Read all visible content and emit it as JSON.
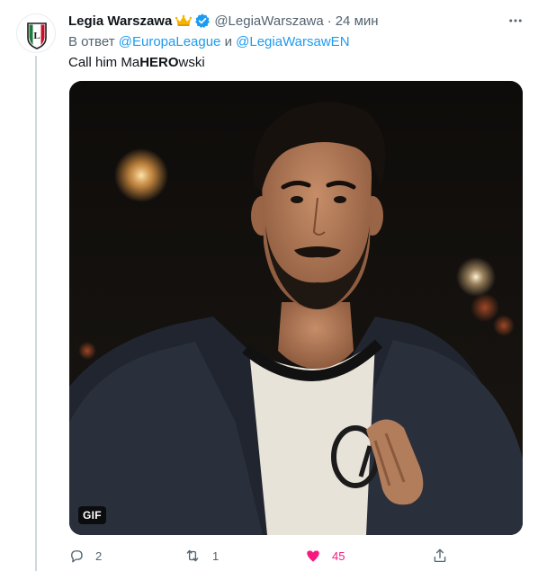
{
  "tweet": {
    "author_name": "Legia Warszawa",
    "handle": "@LegiaWarszawa",
    "separator": "·",
    "time": "24 мин",
    "reply_prefix": "В ответ",
    "reply_mention_1": "@EuropaLeague",
    "reply_conjunction": "и",
    "reply_mention_2": "@LegiaWarsawEN",
    "text_before": "Call him Ma",
    "text_bold": "HERO",
    "text_after": "wski",
    "media_badge": "GIF",
    "replies": "2",
    "retweets": "1",
    "likes": "45"
  },
  "icons": {
    "avatar": "legia-crest-icon",
    "crown": "crown-emoji-icon",
    "verified": "verified-badge-icon",
    "more": "more-dots-icon",
    "reply": "reply-icon",
    "retweet": "retweet-icon",
    "like": "heart-filled-icon",
    "share": "share-icon"
  },
  "colors": {
    "accent": "#1d9bf0",
    "like": "#f91880",
    "muted": "#536471",
    "text": "#0f1419",
    "legia_green": "#1c7a3a"
  }
}
